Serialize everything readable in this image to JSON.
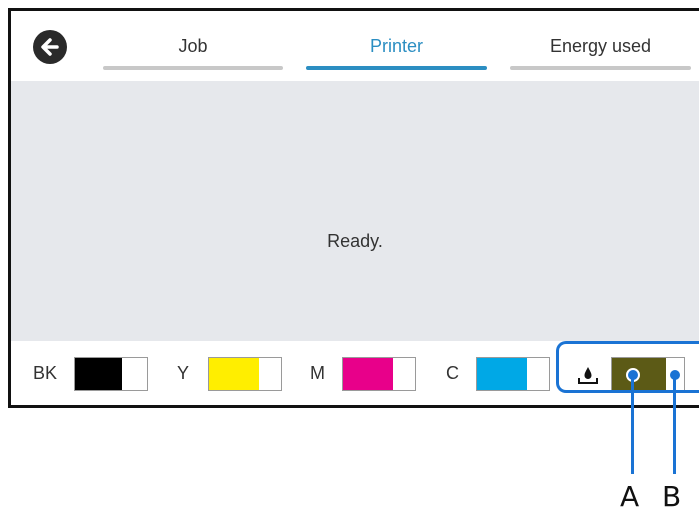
{
  "header": {
    "back_icon": "arrow-left-circle-icon",
    "tabs": [
      {
        "label": "Job",
        "active": false
      },
      {
        "label": "Printer",
        "active": true
      },
      {
        "label": "Energy used",
        "active": false
      }
    ],
    "accent_color": "#2b8ec2"
  },
  "status": {
    "message": "Ready."
  },
  "ink_levels": [
    {
      "label": "BK",
      "color": "#000000",
      "level": 0.65
    },
    {
      "label": "Y",
      "color": "#ffee00",
      "level": 0.7
    },
    {
      "label": "M",
      "color": "#e8008a",
      "level": 0.7
    },
    {
      "label": "C",
      "color": "#00a8e6",
      "level": 0.7
    }
  ],
  "maintenance_box": {
    "icon": "ink-drop-tray-icon",
    "color": "#5c5a16",
    "level": 0.75
  },
  "callouts": {
    "color": "#1a73d4",
    "labels": [
      "A",
      "B"
    ]
  }
}
